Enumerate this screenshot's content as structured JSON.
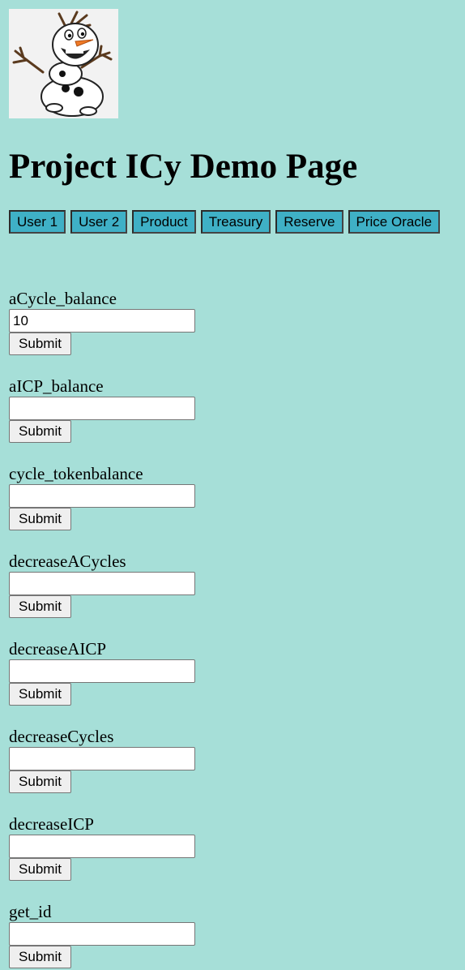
{
  "header": {
    "logo_icon": "snowman-logo-icon",
    "title": "Project ICy Demo Page"
  },
  "tabs": [
    {
      "label": "User 1"
    },
    {
      "label": "User 2"
    },
    {
      "label": "Product"
    },
    {
      "label": "Treasury"
    },
    {
      "label": "Reserve"
    },
    {
      "label": "Price Oracle"
    }
  ],
  "fields": [
    {
      "label": "aCycle_balance",
      "value": "10",
      "submit_label": "Submit"
    },
    {
      "label": "aICP_balance",
      "value": "",
      "submit_label": "Submit"
    },
    {
      "label": "cycle_tokenbalance",
      "value": "",
      "submit_label": "Submit"
    },
    {
      "label": "decreaseACycles",
      "value": "",
      "submit_label": "Submit"
    },
    {
      "label": "decreaseAICP",
      "value": "",
      "submit_label": "Submit"
    },
    {
      "label": "decreaseCycles",
      "value": "",
      "submit_label": "Submit"
    },
    {
      "label": "decreaseICP",
      "value": "",
      "submit_label": "Submit"
    },
    {
      "label": "get_id",
      "value": "",
      "submit_label": "Submit"
    }
  ],
  "colors": {
    "page_background": "#a6dfd8",
    "tab_background": "#3fb0c6",
    "tab_border": "#2b2b2b"
  }
}
